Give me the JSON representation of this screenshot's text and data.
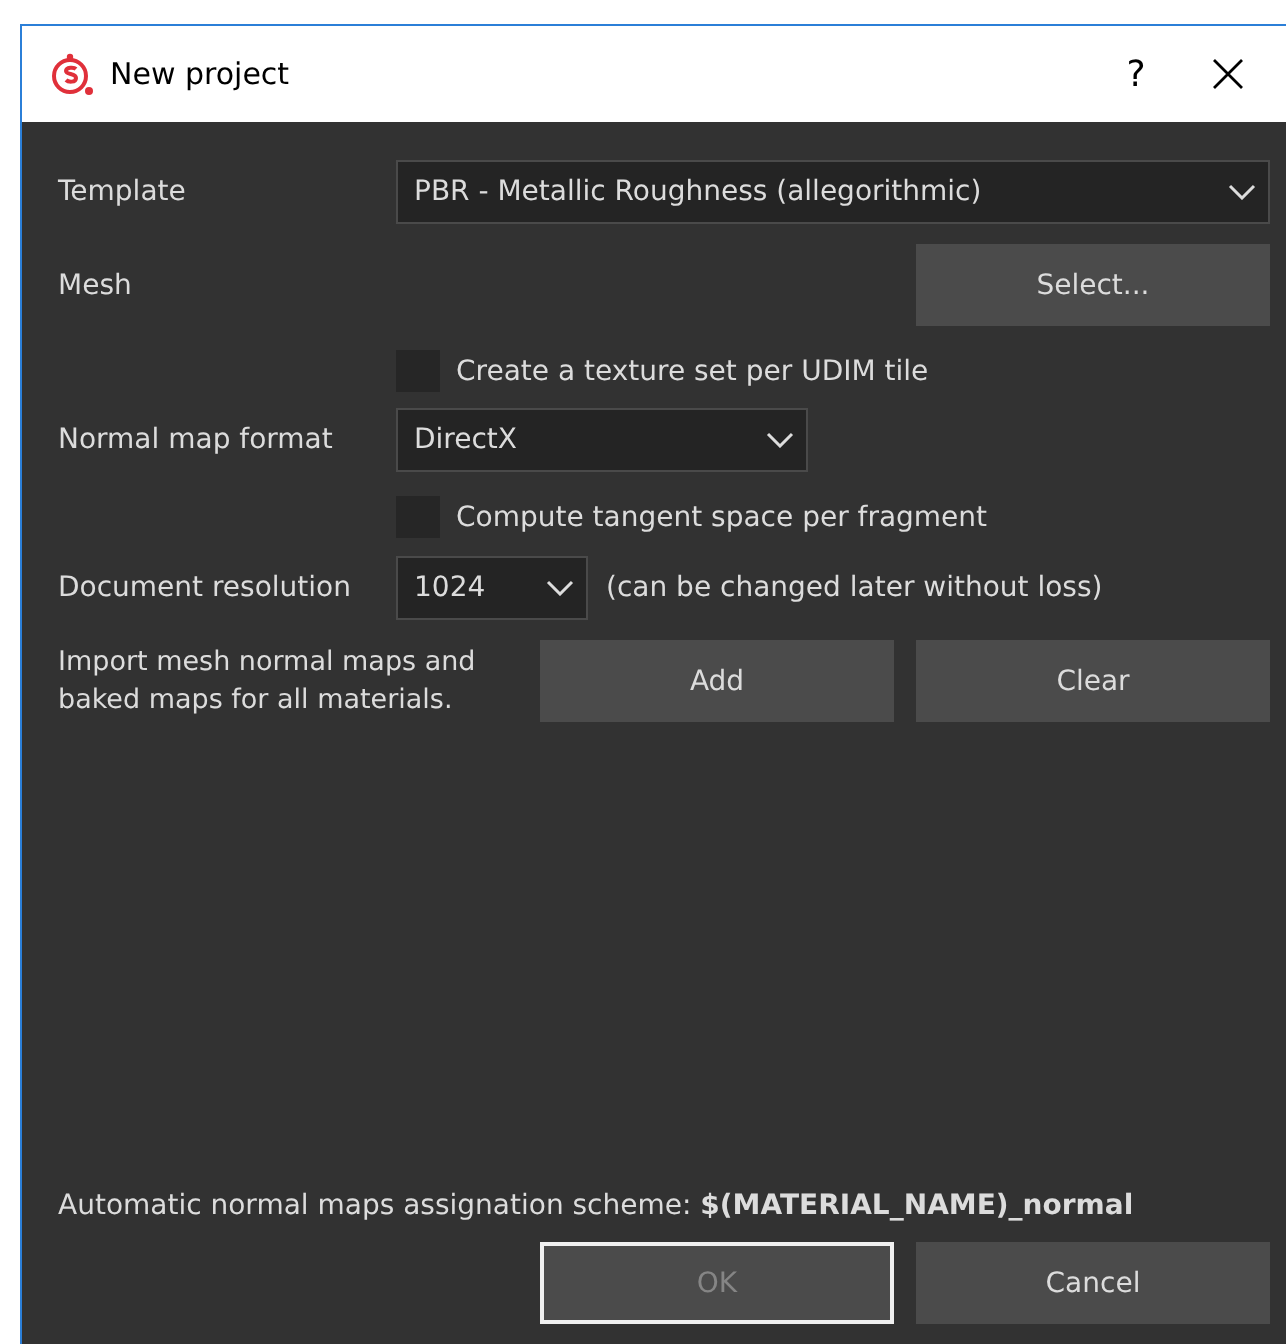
{
  "window": {
    "title": "New project",
    "help": "?"
  },
  "template": {
    "label": "Template",
    "value": "PBR - Metallic Roughness (allegorithmic)"
  },
  "mesh": {
    "label": "Mesh",
    "button": "Select..."
  },
  "udim_checkbox": {
    "label": "Create a texture set per UDIM tile",
    "checked": false
  },
  "normal_map_format": {
    "label": "Normal map format",
    "value": "DirectX"
  },
  "tangent_checkbox": {
    "label": "Compute tangent space per fragment",
    "checked": false
  },
  "resolution": {
    "label": "Document resolution",
    "value": "1024",
    "note": "(can be changed later without loss)"
  },
  "import_maps": {
    "label": "Import mesh normal maps and baked maps for all materials.",
    "buttons": [
      "Add",
      "Clear"
    ]
  },
  "scheme": "Automatic normal maps assignation scheme: **$(MATERIAL_NAME)_normal**",
  "footer_buttons": [
    {
      "label": "OK",
      "disabled": true,
      "default": true
    },
    {
      "label": "Cancel",
      "disabled": false,
      "default": false
    }
  ]
}
